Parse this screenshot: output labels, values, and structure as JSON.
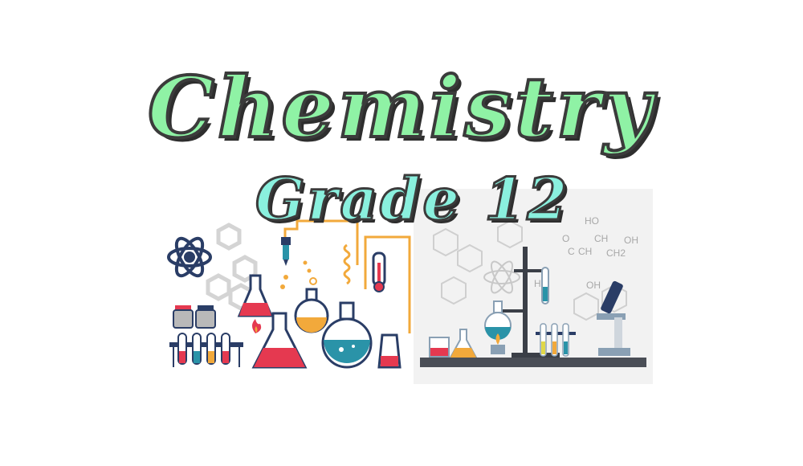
{
  "title": "Chemistry",
  "subtitle": "Grade 12",
  "colors": {
    "title_fill": "#8ff2a5",
    "subtitle_fill": "#8af0de",
    "outline": "#3b3b3b",
    "orange_tube": "#f2a93b",
    "flask_red": "#e53950",
    "flask_teal": "#2a93a8",
    "navy": "#2a3d66",
    "panel_bg": "#f2f2f2"
  },
  "illustrations": {
    "left": "lab-equipment-clipart",
    "right": "laboratory-bench-photo"
  },
  "formula_labels": [
    "HO",
    "OH",
    "CH",
    "CH",
    "CH2",
    "O",
    "C",
    "OH",
    "HO"
  ]
}
